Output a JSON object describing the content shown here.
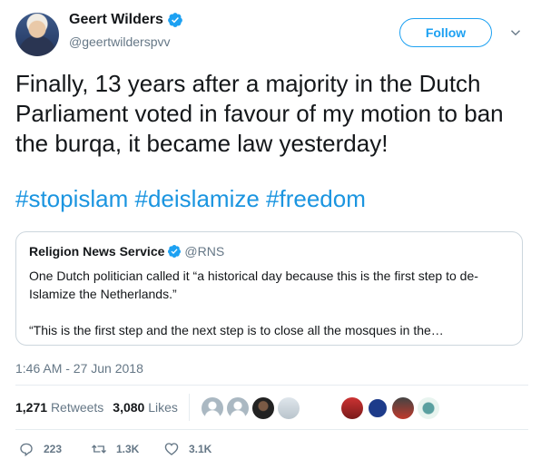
{
  "author": {
    "name": "Geert Wilders",
    "handle": "@geertwilderspvv"
  },
  "follow_label": "Follow",
  "tweet": {
    "text": "Finally, 13 years after a majority in the Dutch Parliament voted in favour of my motion to ban the burqa, it became law yesterday!",
    "hashtags": [
      "#stopislam",
      "#deislamize",
      "#freedom"
    ]
  },
  "quote": {
    "name": "Religion News Service",
    "handle": "@RNS",
    "paragraph1": "One Dutch politician called it “a historical day because this is the first step to de-Islamize the Netherlands.”",
    "paragraph2": "“This is the first step and the next step is to close all the mosques in the…"
  },
  "timestamp": "1:46 AM - 27 Jun 2018",
  "stats": {
    "retweets_count": "1,271",
    "retweets_label": "Retweets",
    "likes_count": "3,080",
    "likes_label": "Likes"
  },
  "actions": {
    "replies": "223",
    "retweets": "1.3K",
    "likes": "3.1K"
  },
  "colors": {
    "accent": "#1da1f2",
    "hashtag": "#1b95e0",
    "secondary_text": "#657786"
  }
}
